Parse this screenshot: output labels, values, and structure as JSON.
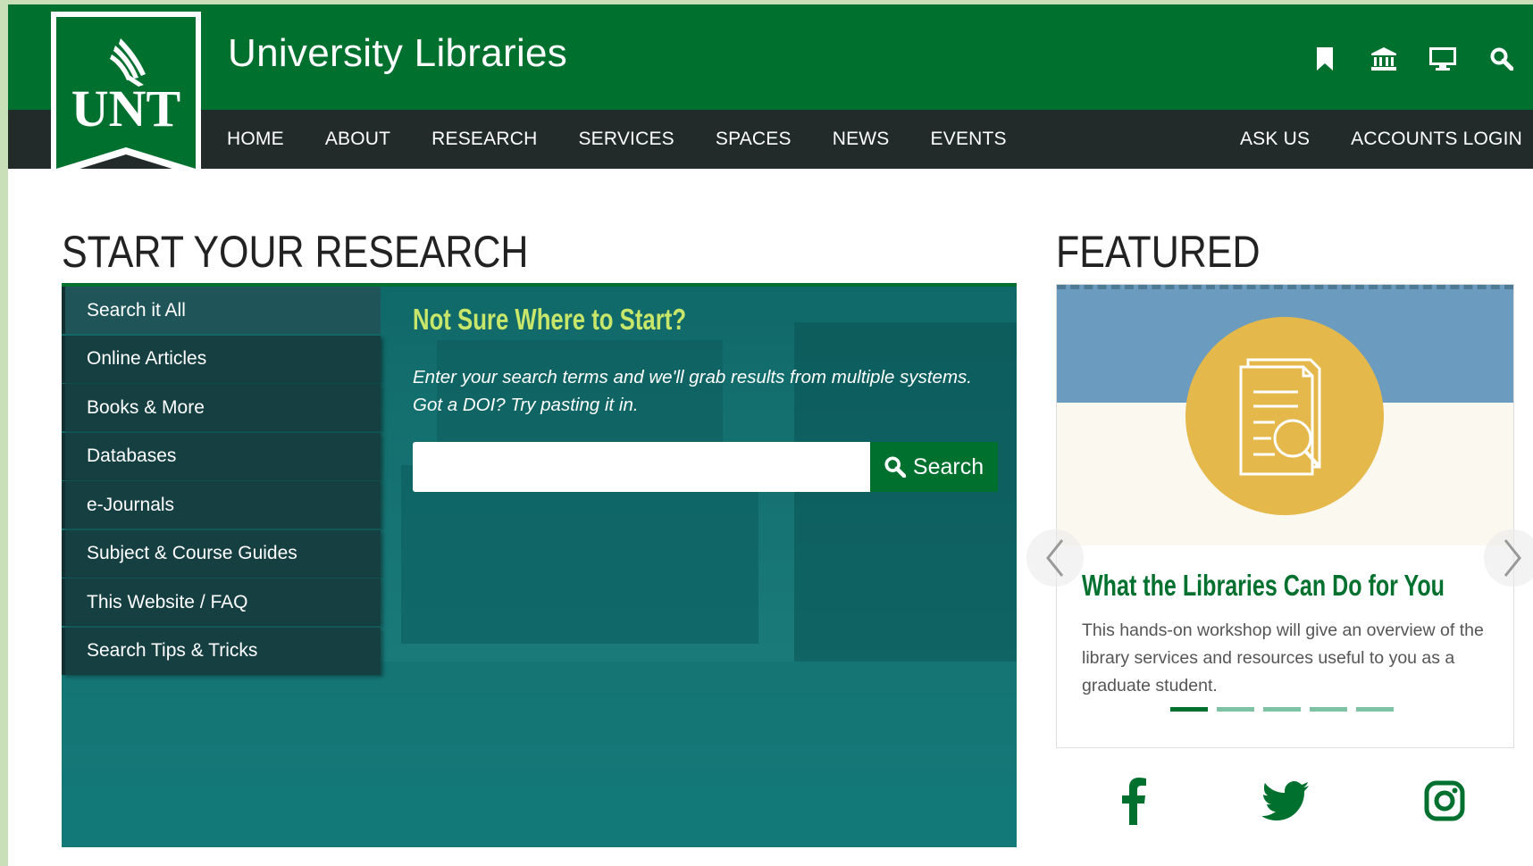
{
  "header": {
    "logo_text": "UNT",
    "site_title": "University Libraries",
    "icons": [
      "bookmark-icon",
      "library-building-icon",
      "monitor-icon",
      "search-icon"
    ]
  },
  "nav": {
    "left": [
      "HOME",
      "ABOUT",
      "RESEARCH",
      "SERVICES",
      "SPACES",
      "NEWS",
      "EVENTS"
    ],
    "right": [
      "ASK US",
      "ACCOUNTS LOGIN"
    ]
  },
  "research": {
    "heading": "START YOUR RESEARCH",
    "tabs": [
      "Search it All",
      "Online Articles",
      "Books & More",
      "Databases",
      "e-Journals",
      "Subject & Course Guides",
      "This Website / FAQ",
      "Search Tips & Tricks"
    ],
    "active_tab": "Search it All",
    "search_title": "Not Sure Where to Start?",
    "search_desc": "Enter your search terms and we'll grab results from multiple systems. Got a DOI? Try pasting it in.",
    "search_value": "",
    "search_placeholder": "",
    "search_button": "Search"
  },
  "featured": {
    "heading": "FEATURED",
    "title": "What the Libraries Can Do for You",
    "text": "This hands-on workshop will give an overview of the library services and resources useful to you as a graduate student.",
    "slide_count": 5,
    "active_slide": 1
  },
  "social": [
    "facebook-icon",
    "twitter-icon",
    "instagram-icon"
  ],
  "colors": {
    "unt_green": "#00702f",
    "nav_dark": "#222a2a",
    "panel_teal": "#006060",
    "accent_lime": "#c7e66a",
    "feature_gold": "#e5b84b",
    "feature_blue": "#6b9bbf"
  }
}
